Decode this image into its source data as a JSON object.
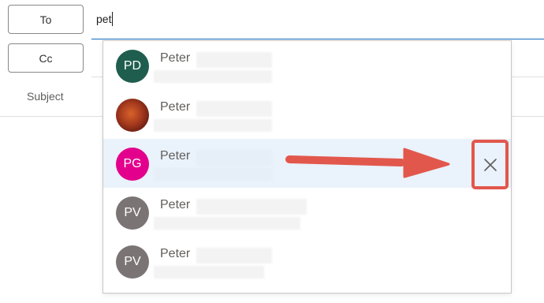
{
  "recipients": {
    "to_button": "To",
    "cc_button": "Cc",
    "subject_label": "Subject",
    "to_value": "pet"
  },
  "suggestions": [
    {
      "name": "Peter",
      "initials": "PD",
      "avatar_color": "#1f5e4e",
      "photo": false,
      "selected": false
    },
    {
      "name": "Peter",
      "initials": "",
      "avatar_color": "#8b2a16",
      "photo": true,
      "selected": false
    },
    {
      "name": "Peter",
      "initials": "PG",
      "avatar_color": "#e3008c",
      "photo": false,
      "selected": true
    },
    {
      "name": "Peter",
      "initials": "PV",
      "avatar_color": "#7a7574",
      "photo": false,
      "selected": false
    },
    {
      "name": "Peter",
      "initials": "PV",
      "avatar_color": "#7a7574",
      "photo": false,
      "selected": false
    }
  ],
  "annotation": {
    "arrow_color": "#e2574c",
    "remove_icon": "close-icon"
  }
}
